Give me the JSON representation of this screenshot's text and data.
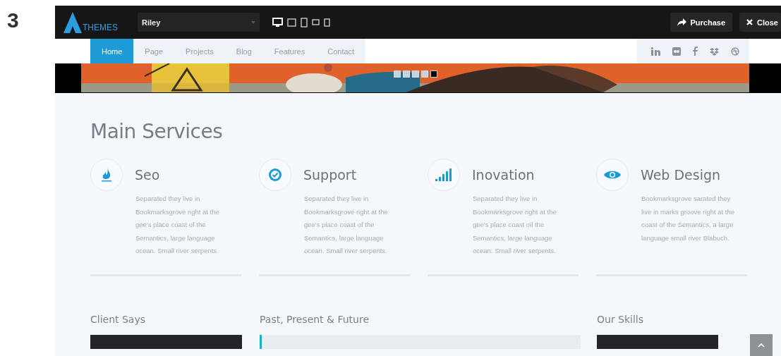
{
  "figure_label": "3",
  "topbar": {
    "logo_text": "THEMES",
    "theme_select": {
      "value": "Riley"
    },
    "devices": [
      {
        "kind": "desktop",
        "selected": true
      },
      {
        "kind": "laptop",
        "selected": false
      },
      {
        "kind": "tablet",
        "selected": false
      },
      {
        "kind": "landscape",
        "selected": false
      },
      {
        "kind": "phone",
        "selected": false
      }
    ],
    "buttons": [
      {
        "kind": "purchase",
        "label": "Purchase"
      },
      {
        "kind": "close",
        "label": "Close"
      }
    ]
  },
  "nav": {
    "items": [
      {
        "label": "Home",
        "selected": true
      },
      {
        "label": "Page",
        "selected": false
      },
      {
        "label": "Projects",
        "selected": false
      },
      {
        "label": "Blog",
        "selected": false
      },
      {
        "label": "Features",
        "selected": false
      },
      {
        "label": "Contact",
        "selected": false
      }
    ]
  },
  "slider": {
    "dots": [
      {
        "selected": false
      },
      {
        "selected": false
      },
      {
        "selected": false
      },
      {
        "selected": false
      },
      {
        "selected": true
      }
    ]
  },
  "services": {
    "title": "Main Services",
    "items": [
      {
        "kind": "flame",
        "title": "Seo",
        "text": "Separated they live in Bookmarksgrove right at the gee's place coast of the Semantics, large language ocean. Small river serpents."
      },
      {
        "kind": "check",
        "title": "Support",
        "text": "Separated they live in Bookmarksgrove right at the gee's place coast of the Semantics, large language ocean. Small river serpents."
      },
      {
        "kind": "signal",
        "title": "Inovation",
        "text": "Separated they live in Bookmarksgrove right at the gee's place coast oil the Semantics, large language ocean. Small river serpents."
      },
      {
        "kind": "eye",
        "title": "Web Design",
        "text": "Bookmarksgrove sarated they live in marks groove right at the coast of the Semantics, a large language small river Blabuch."
      }
    ]
  },
  "sections": [
    {
      "kind": "dark",
      "title": "Client Says"
    },
    {
      "kind": "timeline",
      "title": "Past, Present & Future"
    },
    {
      "kind": "dark",
      "title": "Our Skills"
    }
  ]
}
